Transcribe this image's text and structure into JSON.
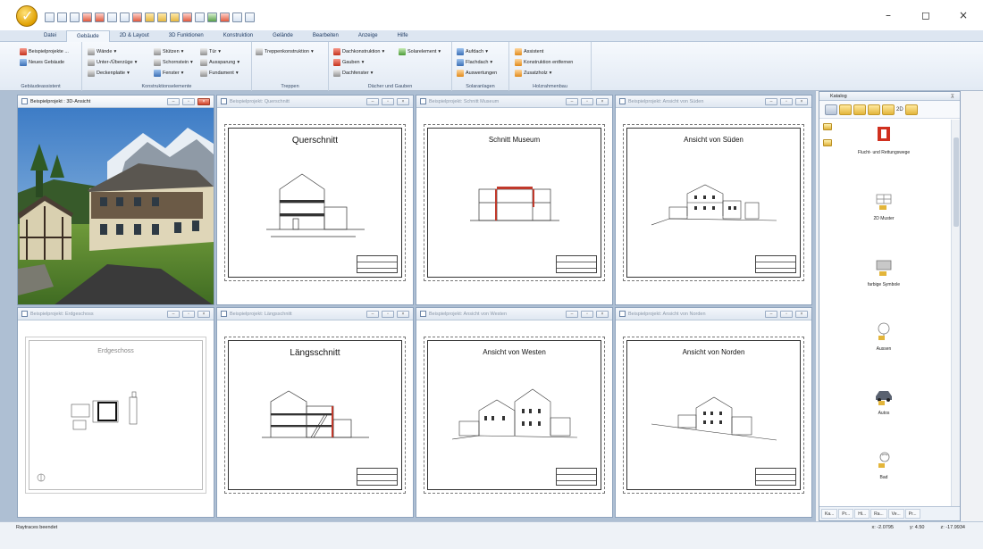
{
  "window": {
    "minimize": "–",
    "maximize": "◻",
    "close": "×"
  },
  "ribbon": {
    "tabs": [
      "Datei",
      "Gebäude",
      "2D & Layout",
      "3D Funktionen",
      "Konstruktion",
      "Gelände",
      "Bearbeiten",
      "Anzeige",
      "Hilfe"
    ],
    "active_tab": "Gebäude",
    "groups": {
      "gebaeudeassistent": {
        "label": "Gebäudeassistent",
        "items": [
          "Beispielprojekte ...",
          "Neues Gebäude"
        ]
      },
      "konstruktionselemente": {
        "label": "Konstruktionselemente",
        "items": [
          "Wände",
          "Unter-/Überzüge",
          "Deckenplatte",
          "Stützen",
          "Schornstein",
          "Fenster",
          "Tür",
          "Aussparung",
          "Fundament"
        ]
      },
      "treppen": {
        "label": "Treppen",
        "items": [
          "Treppenkonstruktion"
        ]
      },
      "daecher": {
        "label": "Dächer und Gauben",
        "items": [
          "Dachkonstruktion",
          "Gauben",
          "Dachfenster",
          "Solarelement"
        ]
      },
      "solaranlagen": {
        "label": "Solaranlagen",
        "items": [
          "Aufdach",
          "Flachdach",
          "Auswertungen"
        ]
      },
      "holzrahmenbau": {
        "label": "Holzrahmenbau",
        "items": [
          "Assistent",
          "Konstruktion entfernen",
          "Zusatzholz"
        ]
      }
    }
  },
  "panes": [
    {
      "title": "Beispielprojekt : 3D-Ansicht",
      "sheet_title": ""
    },
    {
      "title": "Beispielprojekt: Querschnitt",
      "sheet_title": "Querschnitt"
    },
    {
      "title": "Beispielprojekt: Schnitt Museum",
      "sheet_title": "Schnitt Museum"
    },
    {
      "title": "Beispielprojekt: Ansicht von Süden",
      "sheet_title": "Ansicht von Süden"
    },
    {
      "title": "Beispielprojekt: Erdgeschoss",
      "sheet_title": "Erdgeschoss"
    },
    {
      "title": "Beispielprojekt: Längsschnitt",
      "sheet_title": "Längsschnitt"
    },
    {
      "title": "Beispielprojekt: Ansicht von Westen",
      "sheet_title": "Ansicht von Westen"
    },
    {
      "title": "Beispielprojekt: Ansicht von Norden",
      "sheet_title": "Ansicht von Norden"
    }
  ],
  "catalog": {
    "title": "Katalog",
    "toolbar_label": "2D",
    "items": [
      "Flucht- und Rettungswege",
      "2D Muster",
      "farbige Symbole",
      "Aussen",
      "Autos",
      "Bad"
    ],
    "tabs": [
      "Ka...",
      "Pr...",
      "Hi...",
      "Ra...",
      "Ve...",
      "Pr..."
    ]
  },
  "status": {
    "text": "Raytraces beendet",
    "x": "x: -2.0795",
    "y": "y: 4.50",
    "z": "z: -17.9934"
  }
}
